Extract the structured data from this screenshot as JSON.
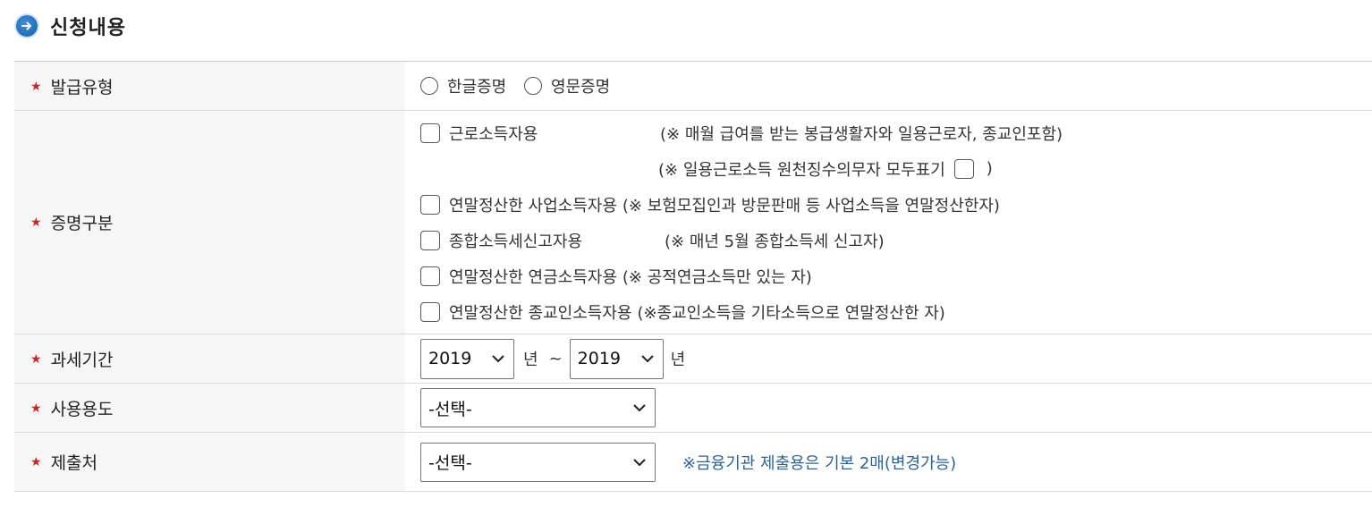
{
  "section": {
    "title": "신청내용"
  },
  "rows": {
    "issue_type": {
      "label": "발급유형",
      "options": [
        "한글증명",
        "영문증명"
      ]
    },
    "cert_type": {
      "label": "증명구분",
      "items": [
        {
          "text": "근로소득자용",
          "note": "(※ 매월 급여를 받는 봉급생활자와 일용근로자, 종교인포함)"
        },
        {
          "sub_note_prefix": "(※ 일용근로소득 원천징수의무자 모두표기",
          "sub_note_suffix": ")"
        },
        {
          "text": "연말정산한 사업소득자용",
          "note": "(※ 보험모집인과 방문판매 등 사업소득을 연말정산한자)"
        },
        {
          "text": "종합소득세신고자용",
          "note": "(※ 매년 5월 종합소득세 신고자)"
        },
        {
          "text": "연말정산한 연금소득자용",
          "note": "(※ 공적연금소득만 있는 자)"
        },
        {
          "text": "연말정산한 종교인소득자용",
          "note": "(※종교인소득을 기타소득으로 연말정산한 자)"
        }
      ]
    },
    "tax_period": {
      "label": "과세기간",
      "from_year": "2019",
      "to_year": "2019",
      "unit": "년",
      "separator": "~"
    },
    "purpose": {
      "label": "사용용도",
      "selected": "-선택-"
    },
    "submit_to": {
      "label": "제출처",
      "selected": "-선택-",
      "hint": "※금융기관 제출용은 기본 2매(변경가능)"
    }
  },
  "colors": {
    "required_star": "#c0282d",
    "hint": "#2a6496",
    "label_bg": "#f6f6f6"
  },
  "icons": {
    "title": "arrow-right-circle-icon",
    "required": "star-icon",
    "dropdown": "chevron-down-icon"
  }
}
